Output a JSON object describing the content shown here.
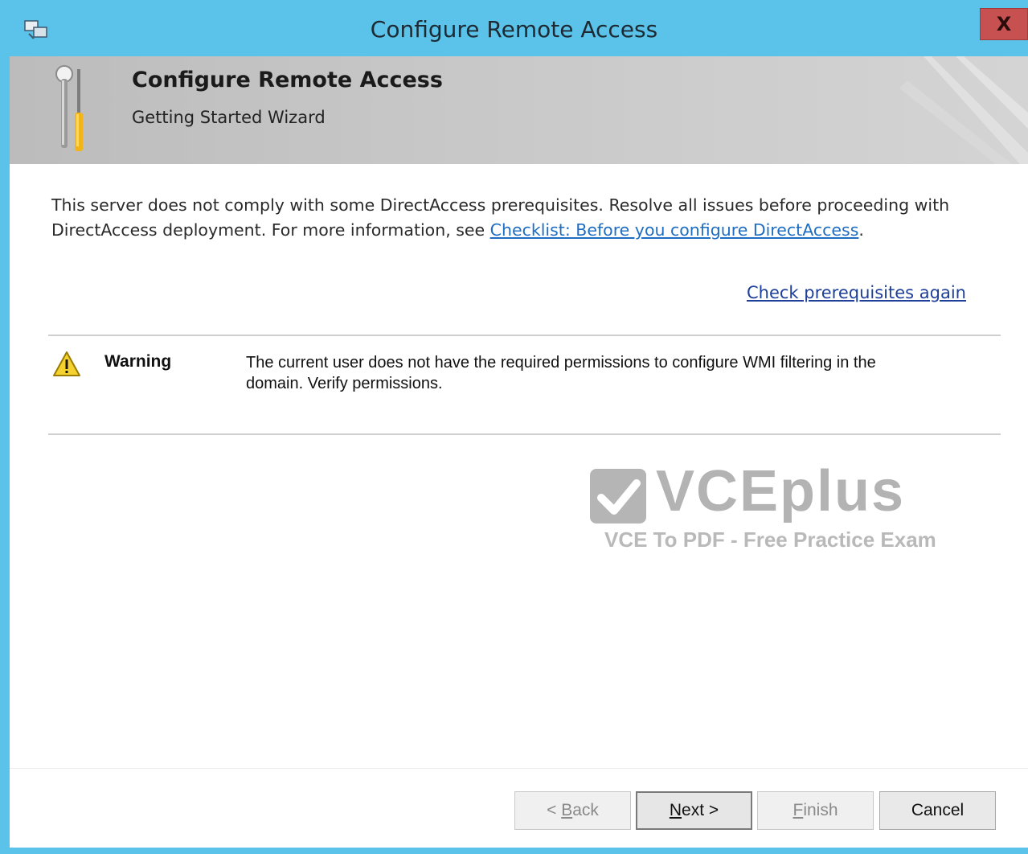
{
  "window": {
    "title": "Configure Remote Access",
    "close_label": "X",
    "accent_color": "#5bc3ea",
    "app_icon": "remote-access-app-icon"
  },
  "header": {
    "title": "Configure Remote Access",
    "subtitle": "Getting Started Wizard",
    "icon": "wrench-screwdriver-icon"
  },
  "intro": {
    "text_before_link": "This server does not comply with some DirectAccess prerequisites. Resolve all issues before proceeding with DirectAccess deployment. For more information, see ",
    "link_text": "Checklist: Before you configure DirectAccess",
    "text_after_link": "."
  },
  "recheck_link": "Check prerequisites again",
  "issues": [
    {
      "severity": "Warning",
      "icon": "warning-icon",
      "message": "The current user does not have the required permissions to configure WMI filtering in the domain. Verify permissions."
    }
  ],
  "watermark": {
    "brand": "VCEplus",
    "tagline": "VCE To PDF - Free Practice Exam"
  },
  "buttons": {
    "back": {
      "prefix": "< ",
      "mnemonic": "B",
      "rest": "ack",
      "enabled": false
    },
    "next": {
      "mnemonic": "N",
      "rest": "ext >",
      "enabled": true
    },
    "finish": {
      "mnemonic": "F",
      "rest": "inish",
      "enabled": false
    },
    "cancel": {
      "label": "Cancel",
      "enabled": true
    }
  }
}
